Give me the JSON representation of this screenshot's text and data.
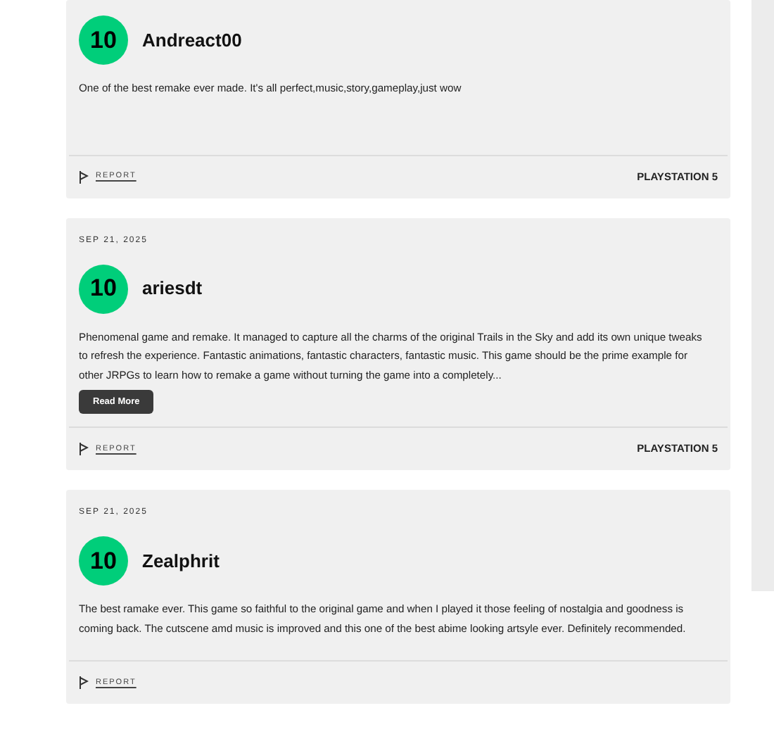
{
  "reviews": [
    {
      "score": "10",
      "username": "Andreact00",
      "text": "One of the best remake ever made. It's all perfect,music,story,gameplay,just wow",
      "report": "REPORT",
      "platform": "PLAYSTATION 5"
    },
    {
      "date": "SEP 21, 2025",
      "score": "10",
      "username": "ariesdt",
      "text": "Phenomenal game and remake. It managed to capture all the charms of the original Trails in the Sky and add its own unique tweaks to refresh the experience. Fantastic animations, fantastic characters, fantastic music. This game should be the prime example for other JRPGs to learn how to remake a game without turning the game into a completely...",
      "read_more": "Read More",
      "report": "REPORT",
      "platform": "PLAYSTATION 5"
    },
    {
      "date": "SEP 21, 2025",
      "score": "10",
      "username": "Zealphrit",
      "text": "The best ramake ever. This game so faithful to the original game and when I played it those feeling of nostalgia and goodness is coming back. The cutscene amd music is improved and this one of the best abime looking artsyle ever. Definitely recommended.",
      "report": "REPORT"
    }
  ]
}
